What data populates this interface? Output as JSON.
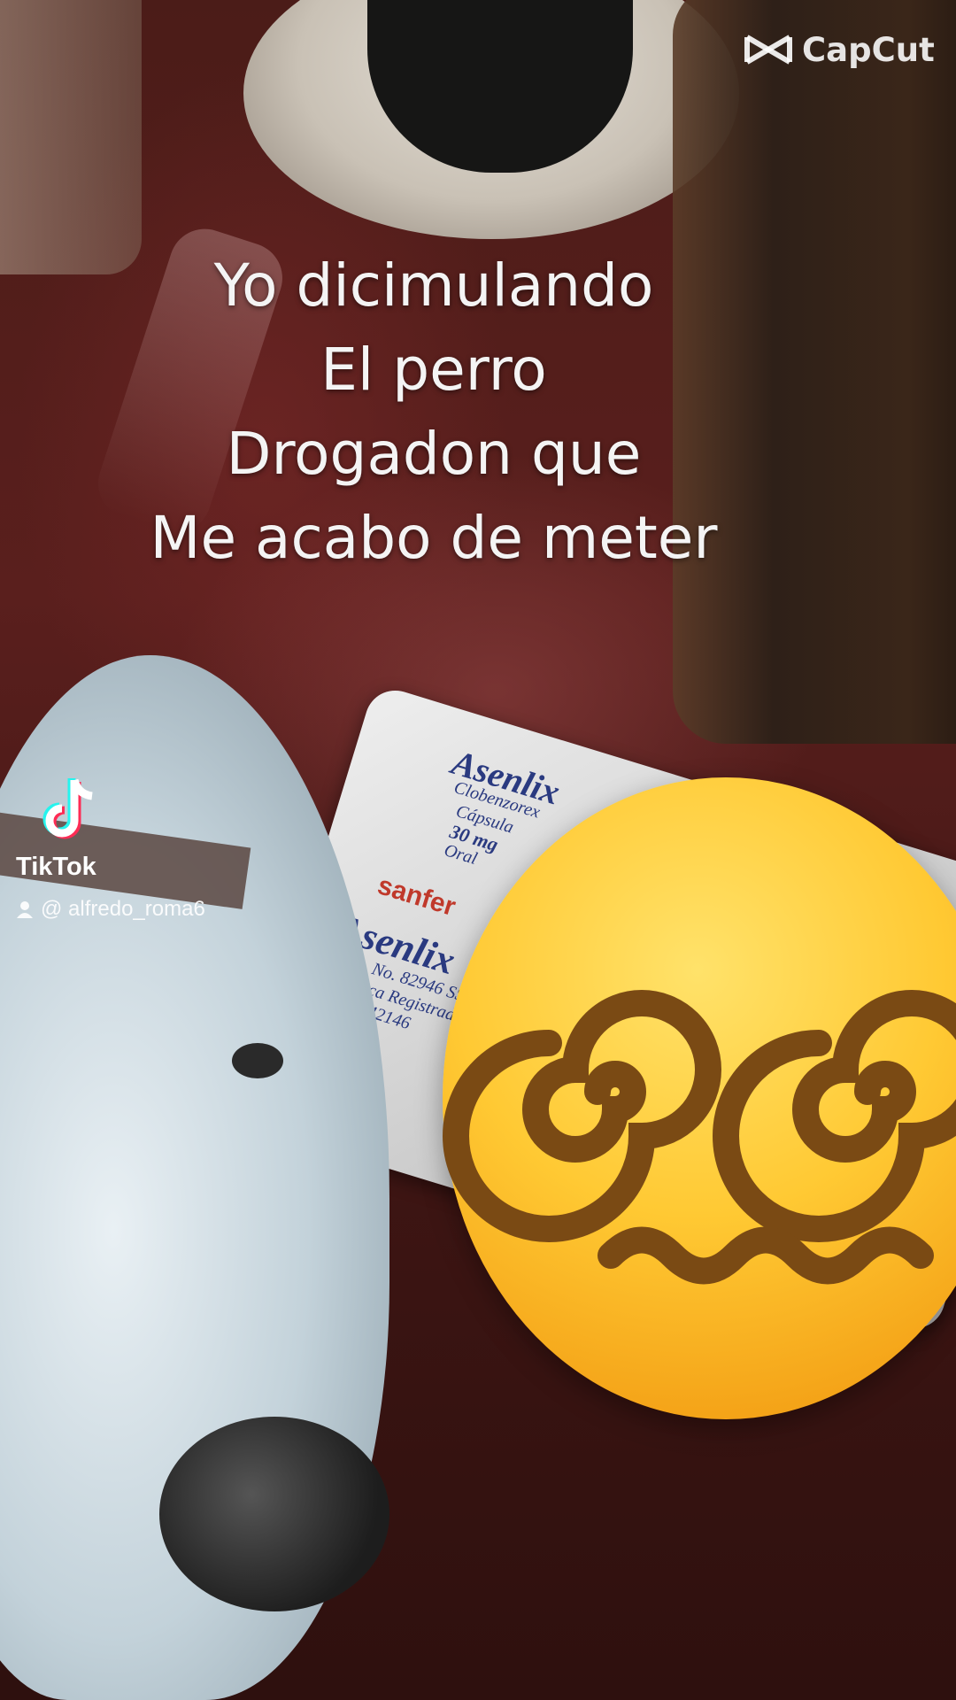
{
  "caption": {
    "lines": [
      "Yo dicimulando",
      "El perro",
      "Drogadon que",
      "Me acabo de meter"
    ]
  },
  "watermarks": {
    "capcut": {
      "label": "CapCut",
      "icon": "capcut-logo-icon"
    },
    "tiktok": {
      "label": "TikTok",
      "icon": "tiktok-logo-icon",
      "user_icon": "person-icon",
      "username": "@ alfredo_roma6"
    }
  },
  "pill_pack": {
    "brand_top": "Asenlix",
    "brand_bottom": "Asenlix",
    "generic": "Clobenzorex",
    "form": "Cápsula",
    "dose": "30 mg",
    "route": "Oral",
    "reg_no": "Reg. No. 82946 SSA IV",
    "trademark": "*Marca Registrada",
    "lot": "1609042146",
    "manufacturer": "sanfer"
  },
  "emoji": {
    "name": "face-with-spiral-eyes-emoji"
  },
  "colors": {
    "caption": "#f4f4f4",
    "emoji_yellow": "#ffc933",
    "spiral": "#7a4a14",
    "pill_brand": "#2a3a80",
    "pill_maker": "#c0392b"
  }
}
